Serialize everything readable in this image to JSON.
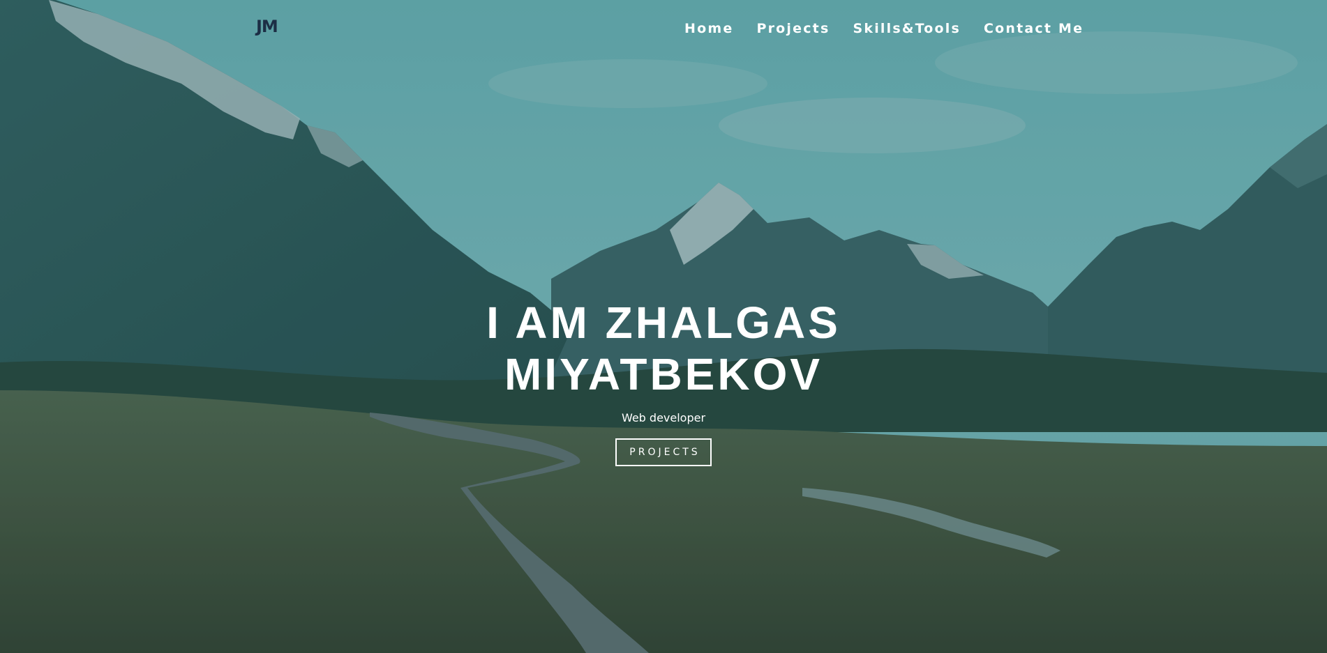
{
  "nav": {
    "logo": "JM",
    "links": [
      "Home",
      "Projects",
      "Skills&Tools",
      "Contact Me"
    ]
  },
  "hero": {
    "title_line1": "I AM ZHALGAS",
    "title_line2": "MIYATBEKOV",
    "subtitle": "Web developer",
    "button_label": "PROJECTS"
  },
  "colors": {
    "logo": "#1c2e45",
    "text": "#ffffff",
    "sky": "#7fc6c8",
    "mountain": "#3d6f6c",
    "grass": "#4a5a3a",
    "path": "#6f7c7b"
  }
}
